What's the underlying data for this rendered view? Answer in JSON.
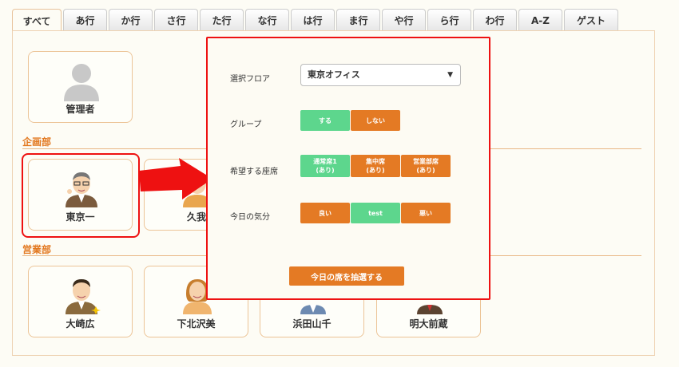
{
  "tabs": [
    "すべて",
    "あ行",
    "か行",
    "さ行",
    "た行",
    "な行",
    "は行",
    "ま行",
    "や行",
    "ら行",
    "わ行",
    "A-Z",
    "ゲスト"
  ],
  "top_user": {
    "name": "管理者"
  },
  "sections": {
    "planning": {
      "title": "企画部",
      "members": [
        "東京一",
        "久我山"
      ]
    },
    "sales": {
      "title": "営業部",
      "members": [
        "大崎広",
        "下北沢美",
        "浜田山千",
        "明大前蔵"
      ]
    }
  },
  "modal": {
    "floor_label": "選択フロア",
    "floor_value": "東京オフィス",
    "group_label": "グループ",
    "group_options": [
      "する",
      "しない"
    ],
    "seat_label": "希望する座席",
    "seat_options": [
      {
        "line1": "通常席1",
        "line2": "(あり)"
      },
      {
        "line1": "集中席",
        "line2": "(あり)"
      },
      {
        "line1": "営業部席",
        "line2": "(あり)"
      }
    ],
    "mood_label": "今日の気分",
    "mood_options": [
      "良い",
      "test",
      "悪い"
    ],
    "draw_button": "今日の席を抽選する"
  },
  "colors": {
    "accent": "#e47a24",
    "selected": "#5dd68d",
    "highlight": "#ee1111"
  }
}
